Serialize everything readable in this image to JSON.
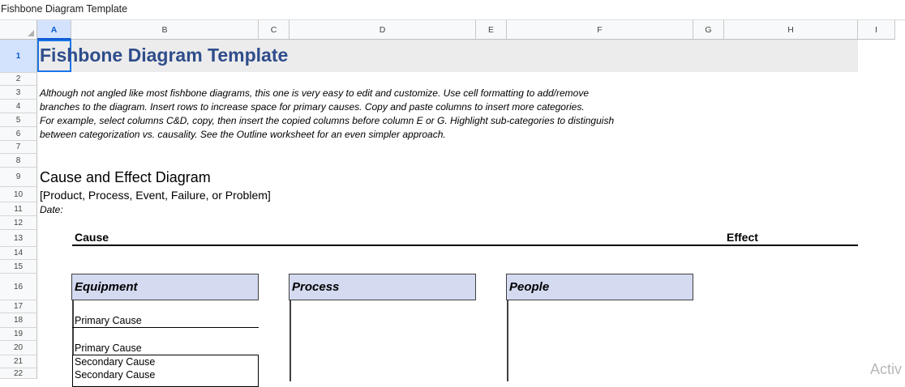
{
  "window": {
    "title": "Fishbone Diagram Template"
  },
  "columns": [
    "A",
    "B",
    "C",
    "D",
    "E",
    "F",
    "G",
    "H",
    "I"
  ],
  "rows": [
    "1",
    "2",
    "3",
    "4",
    "5",
    "6",
    "7",
    "8",
    "9",
    "10",
    "11",
    "12",
    "13",
    "14",
    "15",
    "16",
    "17",
    "18",
    "19",
    "20",
    "21",
    "22"
  ],
  "sheet": {
    "title": "Fishbone Diagram Template",
    "description": [
      "Although not angled like most fishbone diagrams, this one is very easy to edit and customize. Use cell formatting to add/remove",
      "branches to the diagram. Insert rows to increase space for primary causes. Copy and paste columns to insert more categories.",
      "For example, select columns C&D, copy, then insert the copied columns before column E or G. Highlight sub-categories to distinguish",
      "between categorization vs. causality. See the Outline worksheet for an even simpler approach."
    ],
    "heading": "Cause and Effect Diagram",
    "subheading": "[Product, Process, Event, Failure, or Problem]",
    "date_label": "Date:",
    "cause_label": "Cause",
    "effect_label": "Effect",
    "categories": [
      "Equipment",
      "Process",
      "People"
    ],
    "primary_cause_1": "Primary Cause",
    "primary_cause_2": "Primary Cause",
    "secondary_cause_1": "Secondary Cause",
    "secondary_cause_2": "Secondary Cause"
  },
  "overlay": {
    "watermark": "Activ"
  },
  "colors": {
    "title": "#2f4d8b",
    "category_fill": "#d4daf0",
    "selection": "#1a73e8"
  }
}
